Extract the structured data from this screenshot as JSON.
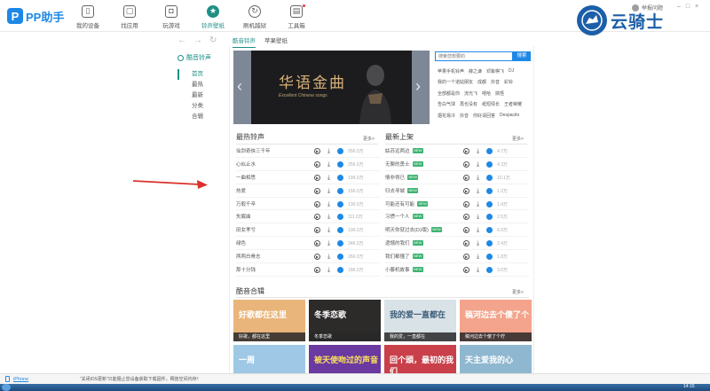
{
  "app": {
    "name": "PP助手"
  },
  "nav": [
    {
      "label": "我的设备",
      "icon": "phone-icon"
    },
    {
      "label": "找应用",
      "icon": "apps-icon"
    },
    {
      "label": "玩游戏",
      "icon": "game-icon"
    },
    {
      "label": "铃声壁纸",
      "icon": "ringtone-icon"
    },
    {
      "label": "刷机越狱",
      "icon": "flash-icon"
    },
    {
      "label": "工具箱",
      "icon": "toolbox-icon"
    }
  ],
  "user": {
    "label": "举报问题"
  },
  "watermark": {
    "text": "云骑士"
  },
  "subtabs": [
    "酷音铃声",
    "苹果壁纸"
  ],
  "left_menu": {
    "title": "酷音铃声",
    "items": [
      "首页",
      "最热",
      "最新",
      "分类",
      "合辑"
    ]
  },
  "banner": {
    "title": "华语金曲",
    "subtitle": "Excellent Chinese songs"
  },
  "search": {
    "placeholder": "搜索您想要的",
    "button": "搜索"
  },
  "hot_tags": [
    [
      "苹果手机铃声",
      "薛之谦",
      "邓紫棋飞",
      "DJ"
    ],
    [
      "我的一个道姑朋友",
      "成都",
      "抖音",
      "彩铃"
    ],
    [
      "全部都是你",
      "流光飞",
      "嘻哈",
      "搞怪"
    ],
    [
      "告白气球",
      "再也没有",
      "纸短情长",
      "王者荣耀"
    ],
    [
      "烟花易冷",
      "抖音",
      "你好请回答",
      "Despacito"
    ]
  ],
  "hot": {
    "title": "最热铃声",
    "more": "更多>",
    "songs": [
      {
        "name": "仙剑奇侠三千年",
        "count": "556.0万",
        "new": false
      },
      {
        "name": "心似止水",
        "count": "256.0万",
        "new": false
      },
      {
        "name": "一曲相思",
        "count": "199.0万",
        "new": false
      },
      {
        "name": "热爱",
        "count": "156.0万",
        "new": false
      },
      {
        "name": "万般千辛",
        "count": "130.0万",
        "new": false
      },
      {
        "name": "失眠曲",
        "count": "111.0万",
        "new": false
      },
      {
        "name": "田女孝兮",
        "count": "100.0万",
        "new": false
      },
      {
        "name": "绿色",
        "count": "246.0万",
        "new": false
      },
      {
        "name": "两两白骨志",
        "count": "266.0万",
        "new": false
      },
      {
        "name": "那十分钱",
        "count": "186.0万",
        "new": false
      }
    ]
  },
  "latest": {
    "title": "最新上架",
    "more": "更多>",
    "songs": [
      {
        "name": "姑苏远两边",
        "count": "4.7万",
        "new": true
      },
      {
        "name": "无聊的勇士",
        "count": "4.3万",
        "new": true
      },
      {
        "name": "情非得已",
        "count": "10.1万",
        "new": true
      },
      {
        "name": "归去寻城",
        "count": "1.2万",
        "new": true
      },
      {
        "name": "可能还有可能",
        "count": "1.4万",
        "new": true
      },
      {
        "name": "习惯一个人",
        "count": "2.5万",
        "new": true
      },
      {
        "name": "明天你就过去(DJ版)",
        "count": "6.0万",
        "new": true
      },
      {
        "name": "遗憾的我们",
        "count": "2.4万",
        "new": true
      },
      {
        "name": "我们都懂了",
        "count": "1.8万",
        "new": true
      },
      {
        "name": "小藤机故事",
        "count": "3.0万",
        "new": true
      }
    ]
  },
  "albums": {
    "title": "酷音合辑",
    "more": "更多>",
    "row1": [
      {
        "art": "好歌都在这里",
        "label": "好歌，都在这里",
        "bg": "#e9b57a",
        "fg": "#fff"
      },
      {
        "art": "冬季恋歌",
        "label": "冬季恋歌",
        "bg": "#2d2a2a",
        "fg": "#fff"
      },
      {
        "art": "我的爱一直都在",
        "label": "我的爱，一直都在",
        "bg": "#d9e2e6",
        "fg": "#3b5c78"
      },
      {
        "art": "稿河边去个傻了个",
        "label": "稿河边去个傻了个柠",
        "bg": "#f4a48c",
        "fg": "#fff"
      }
    ],
    "row2": [
      {
        "art": "一周",
        "bg": "#9ec8e6",
        "fg": "#fff"
      },
      {
        "art": "被天使吻过的声音",
        "bg": "#6a3aa0",
        "fg": "#fde35a"
      },
      {
        "art": "回个頭，最初的我们",
        "bg": "#c9404a",
        "fg": "#fff"
      },
      {
        "art": "天主爱我的心",
        "bg": "#8fb8d0",
        "fg": "#fff"
      }
    ]
  },
  "status": {
    "device": "iPhone",
    "notice": "“关闭iOS更新”只能阻止您设备获取下载固件，释放空间内存！"
  },
  "tray": {
    "time": "14:15"
  }
}
